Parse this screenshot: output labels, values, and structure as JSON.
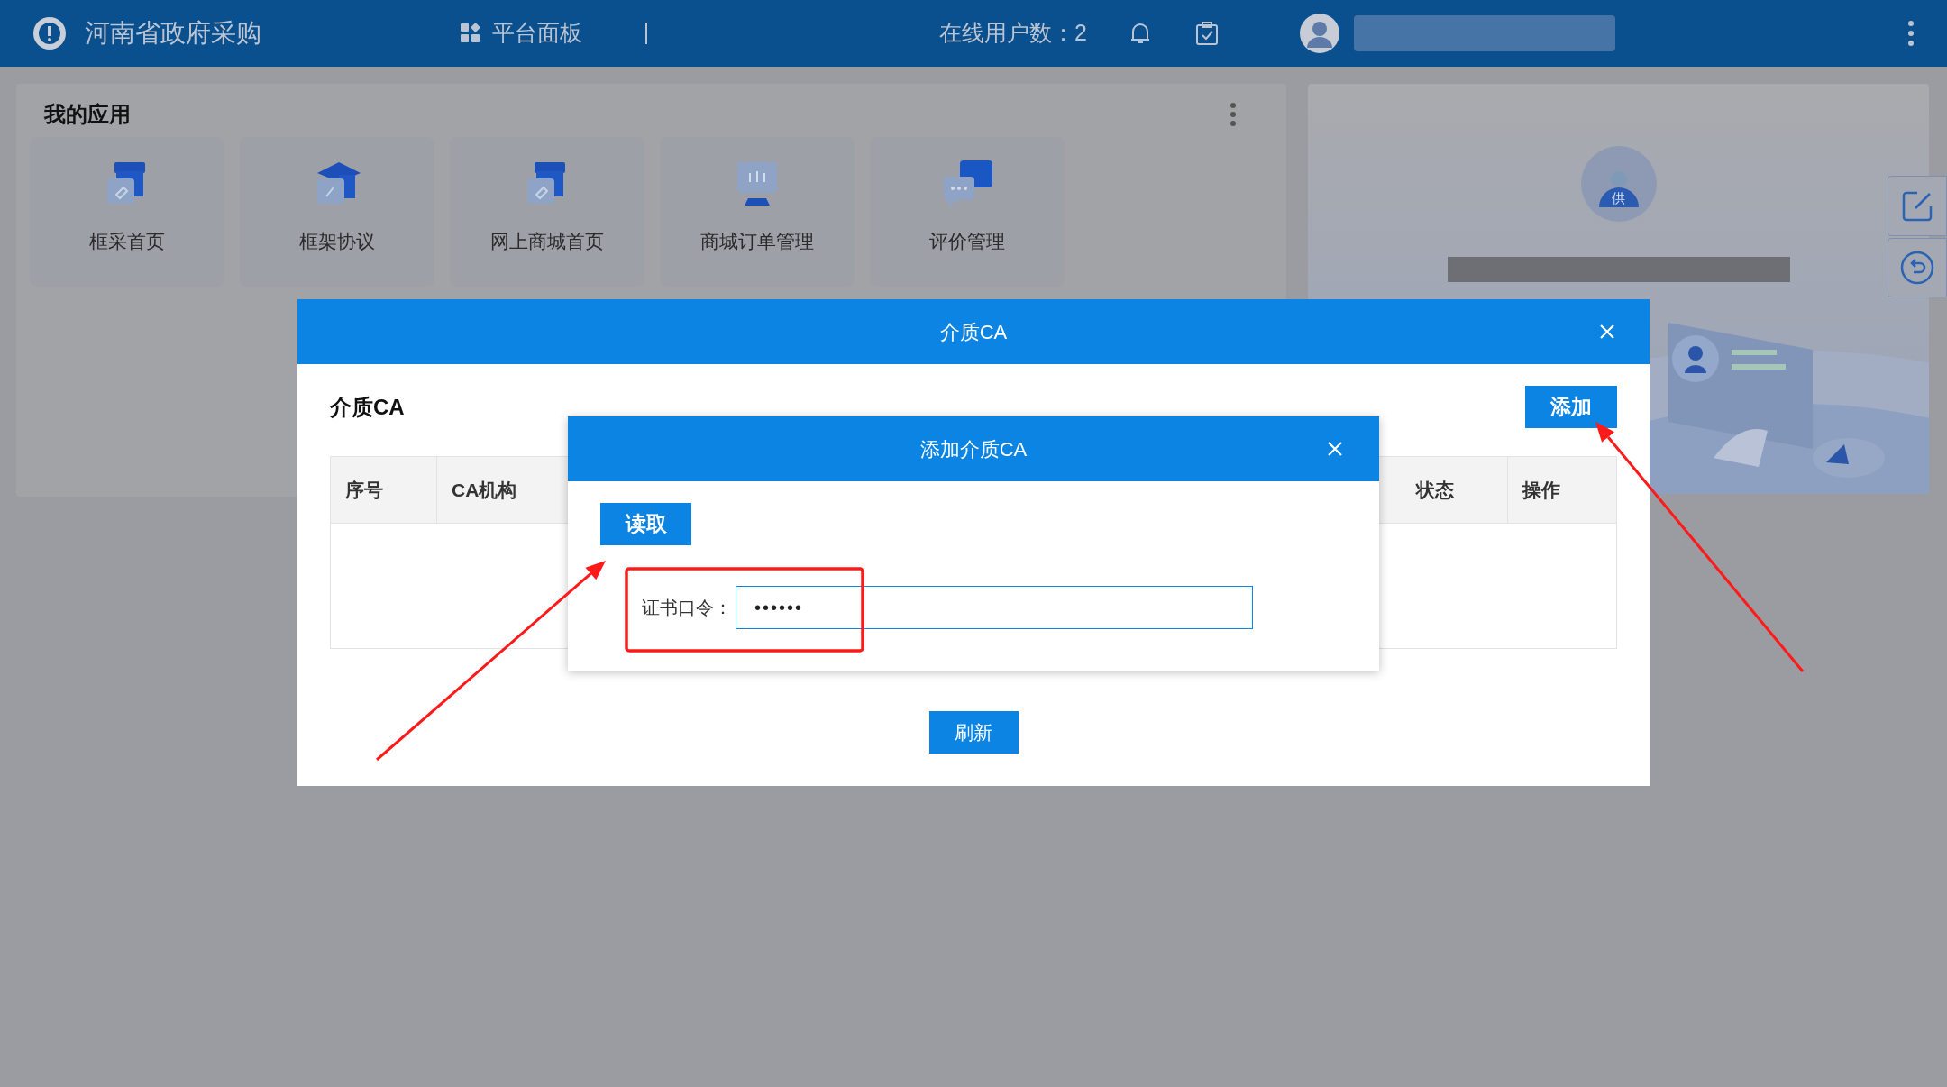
{
  "header": {
    "title": "河南省政府采购",
    "nav_label": "平台面板",
    "online_users": "在线用户数：2"
  },
  "apps_card": {
    "title": "我的应用",
    "tiles": [
      {
        "label": "框采首页"
      },
      {
        "label": "框架协议"
      },
      {
        "label": "网上商城首页"
      },
      {
        "label": "商城订单管理"
      },
      {
        "label": "评价管理"
      }
    ]
  },
  "profile_card": {
    "avatar_badge": "供"
  },
  "ca_dialog": {
    "title": "介质CA",
    "section_title": "介质CA",
    "add_button": "添加",
    "columns": [
      {
        "label": "序号"
      },
      {
        "label": "CA机构"
      },
      {
        "label": "状态"
      },
      {
        "label": "操作"
      }
    ],
    "refresh_button": "刷新"
  },
  "add_dialog": {
    "title": "添加介质CA",
    "read_button": "读取",
    "password_label": "证书口令：",
    "password_value": "••••••"
  },
  "annotations": [
    {
      "kind": "box"
    },
    {
      "kind": "arrow"
    },
    {
      "kind": "arrow"
    }
  ]
}
